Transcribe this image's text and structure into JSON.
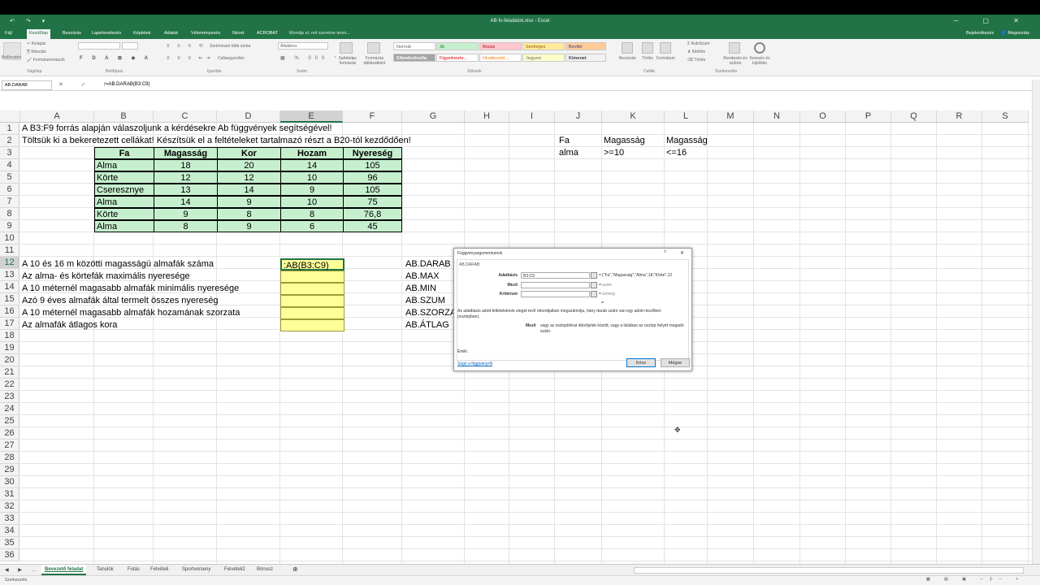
{
  "titlebar": {
    "title": "AB-fv-feladatok.xlsx - Excel",
    "quick_access": "↶ ↷ ▾"
  },
  "tabs": [
    "Fájl",
    "Kezdőlap",
    "Beszúrás",
    "Lapelrendezés",
    "Képletek",
    "Adatok",
    "Véleményezés",
    "Nézet",
    "ACROBAT",
    "Mondja el, mit szeretne tenni..."
  ],
  "account": {
    "signin": "Bejelentkezés",
    "share": "Megosztás"
  },
  "ribbon": {
    "clipboard": {
      "paste": "Beillesztés",
      "cut": "Kivágás",
      "copy": "Másolás",
      "format": "Formátummásoló",
      "label": "Vágólap"
    },
    "font": {
      "label": "Betűtípus"
    },
    "align": {
      "wrap": "Sortöréssel több sorba",
      "merge": "Cellaegyesítés",
      "label": "Igazítás"
    },
    "number": {
      "format": "Általános",
      "label": "Szám"
    },
    "styles": {
      "cond": "Feltételes formázás",
      "table": "Formázás táblázatként",
      "items": [
        "Normál",
        "Jó",
        "Rossz",
        "Semleges",
        "Bevitel",
        "Ellenőrzőcella",
        "Figyelmezte...",
        "Hivatkozott ...",
        "Jegyzet",
        "Kimenet"
      ],
      "label": "Stílusok"
    },
    "cells": {
      "insert": "Beszúrás",
      "delete": "Törlés",
      "format": "Formátum",
      "label": "Cellák"
    },
    "editing": {
      "autosum": "AutoSzum",
      "fill": "Kitöltés",
      "clear": "Törlés",
      "sort": "Rendezés és szűrés",
      "find": "Keresés és kijelölés",
      "label": "Szerkesztés"
    }
  },
  "formula_bar": {
    "name_box": "AB.DARAB",
    "formula": "=AB.DARAB(B3:C9)"
  },
  "columns": [
    "A",
    "B",
    "C",
    "D",
    "E",
    "F",
    "G",
    "H",
    "I",
    "J",
    "K",
    "L",
    "M",
    "N",
    "O",
    "P",
    "Q",
    "R",
    "S"
  ],
  "rows": [
    "1",
    "2",
    "3",
    "4",
    "5",
    "6",
    "7",
    "8",
    "9",
    "10",
    "11",
    "12",
    "13",
    "14",
    "15",
    "16",
    "17",
    "18",
    "19",
    "20",
    "21",
    "22",
    "23",
    "24",
    "25",
    "26",
    "27",
    "28",
    "29",
    "30",
    "31",
    "32",
    "33",
    "34",
    "35",
    "36"
  ],
  "sheet": {
    "a1": "A B3:F9 forrás alapján válaszoljunk a kérdésekre Ab függvények segítségével!",
    "a2": "Töltsük ki a bekeretezett cellákat! Készítsük el a feltételeket tartalmazó részt a B20-tól kezdődően!",
    "table_headers": [
      "Fa",
      "Magasság",
      "Kor",
      "Hozam",
      "Nyereség"
    ],
    "table_rows": [
      [
        "Alma",
        "18",
        "20",
        "14",
        "105"
      ],
      [
        "Körte",
        "12",
        "12",
        "10",
        "96"
      ],
      [
        "Cseresznye",
        "13",
        "14",
        "9",
        "105"
      ],
      [
        "Alma",
        "14",
        "9",
        "10",
        "75"
      ],
      [
        "Körte",
        "9",
        "8",
        "8",
        "76,8"
      ],
      [
        "Alma",
        "8",
        "9",
        "6",
        "45"
      ]
    ],
    "questions": [
      "A 10 és 16 m közötti magasságú almafák száma",
      "Az alma- és körtefák maximális nyeresége",
      "A 10 méternél magasabb almafák minimális nyeresége",
      "Azó 9 éves almafák által termelt összes nyereség",
      "A 10 méternél magasabb almafák hozamának szorzata",
      "Az almafák átlagos kora"
    ],
    "e12": ":AB(B3:C9)",
    "functions": [
      "AB.DARAB",
      "AB.MAX",
      "AB.MIN",
      "AB.SZUM",
      "AB.SZORZAT",
      "AB.ÁTLAG"
    ],
    "criteria": {
      "j2": "Fa",
      "k2": "Magasság",
      "l2": "Magasság",
      "j3": "alma",
      "k3": ">=10",
      "l3": "<=16"
    }
  },
  "dialog": {
    "title": "Függvényargumentumok",
    "func": "AB.DARAB",
    "args": [
      {
        "label": "Adatbázis",
        "value": "B3:C9",
        "result": "{\"Fa\",\"Magasság\";\"Alma\",18;\"Körte\",12"
      },
      {
        "label": "Mező",
        "value": "",
        "result": "szám"
      },
      {
        "label": "Kritérium",
        "value": "",
        "result": "szöveg"
      }
    ],
    "eq": "=",
    "result_mark": "=",
    "desc": "Az adatbázis adott feltételeknek eleget tevő rekordjaiban megszámolja, hány darab szám van egy adott mezőben (oszlopban).",
    "arg_name": "Mező",
    "arg_desc": "vagy az oszlopfelirat idézőjelek között, vagy a listában az oszlop helyét megadó szám.",
    "value_label": "Érték:",
    "help": "Súgó a függvényről",
    "ok": "Kész",
    "cancel": "Mégse",
    "close": "✕",
    "q": "?"
  },
  "sheet_tabs": [
    "Bevezető feladat",
    "Tanulók",
    "Futás",
    "Felvételi",
    "Sportverseny",
    "Felvételi2",
    "Bónusz"
  ],
  "status": "Szerkesztés",
  "colors": {
    "excel_green": "#217346",
    "table_fill": "#c6efce",
    "answer_fill": "#ffff99"
  }
}
